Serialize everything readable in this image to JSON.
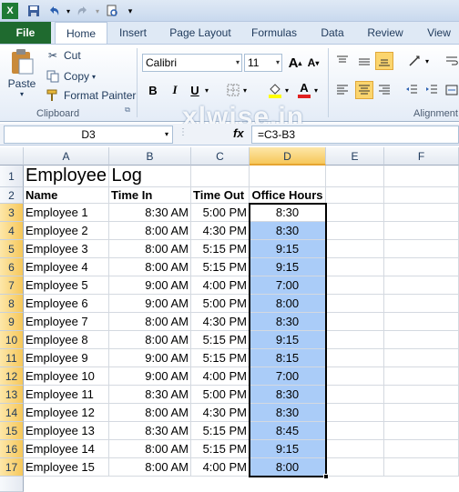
{
  "qat": {
    "excel_icon": "excel-icon",
    "save_icon": "save-icon",
    "undo_icon": "undo-icon",
    "redo_icon": "redo-icon",
    "print_preview_icon": "print-preview-icon"
  },
  "tabs": [
    {
      "id": "file",
      "label": "File"
    },
    {
      "id": "home",
      "label": "Home"
    },
    {
      "id": "insert",
      "label": "Insert"
    },
    {
      "id": "page-layout",
      "label": "Page Layout"
    },
    {
      "id": "formulas",
      "label": "Formulas"
    },
    {
      "id": "data",
      "label": "Data"
    },
    {
      "id": "review",
      "label": "Review"
    },
    {
      "id": "view",
      "label": "View"
    }
  ],
  "ribbon": {
    "clipboard": {
      "paste_label": "Paste",
      "cut_label": "Cut",
      "copy_label": "Copy",
      "format_painter_label": "Format Painter",
      "group_label": "Clipboard"
    },
    "font": {
      "font_name": "Calibri",
      "font_size": "11",
      "bold": "B",
      "italic": "I",
      "underline": "U",
      "font_color_letter": "A",
      "grow_font": "A",
      "shrink_font": "A"
    },
    "alignment": {
      "group_label": "Alignment"
    },
    "watermark": "xlwise.in",
    "accent_colors": {
      "file_tab": "#1f6a2f",
      "selection_fill": "#aaccf8",
      "header_highlight": "#f6c75a"
    }
  },
  "formula_bar": {
    "name_box": "D3",
    "fx_label": "fx",
    "formula": "=C3-B3"
  },
  "sheet": {
    "columns": [
      "A",
      "B",
      "C",
      "D",
      "E",
      "F"
    ],
    "rows": [
      [
        "1",
        "Employee Log",
        "",
        "",
        ""
      ],
      [
        "2",
        "Name",
        "Time In",
        "Time Out",
        "Office Hours"
      ],
      [
        "3",
        "Employee 1",
        "8:30 AM",
        "5:00 PM",
        "8:30"
      ],
      [
        "4",
        "Employee 2",
        "8:00 AM",
        "4:30 PM",
        "8:30"
      ],
      [
        "5",
        "Employee 3",
        "8:00 AM",
        "5:15 PM",
        "9:15"
      ],
      [
        "6",
        "Employee 4",
        "8:00 AM",
        "5:15 PM",
        "9:15"
      ],
      [
        "7",
        "Employee 5",
        "9:00 AM",
        "4:00 PM",
        "7:00"
      ],
      [
        "8",
        "Employee 6",
        "9:00 AM",
        "5:00 PM",
        "8:00"
      ],
      [
        "9",
        "Employee 7",
        "8:00 AM",
        "4:30 PM",
        "8:30"
      ],
      [
        "10",
        "Employee 8",
        "8:00 AM",
        "5:15 PM",
        "9:15"
      ],
      [
        "11",
        "Employee 9",
        "9:00 AM",
        "5:15 PM",
        "8:15"
      ],
      [
        "12",
        "Employee 10",
        "9:00 AM",
        "4:00 PM",
        "7:00"
      ],
      [
        "13",
        "Employee 11",
        "8:30 AM",
        "5:00 PM",
        "8:30"
      ],
      [
        "14",
        "Employee 12",
        "8:00 AM",
        "4:30 PM",
        "8:30"
      ],
      [
        "15",
        "Employee 13",
        "8:30 AM",
        "5:15 PM",
        "8:45"
      ],
      [
        "16",
        "Employee 14",
        "8:00 AM",
        "5:15 PM",
        "9:15"
      ],
      [
        "17",
        "Employee 15",
        "8:00 AM",
        "4:00 PM",
        "8:00"
      ]
    ],
    "active_cell": "D3",
    "selected_column": "D"
  }
}
